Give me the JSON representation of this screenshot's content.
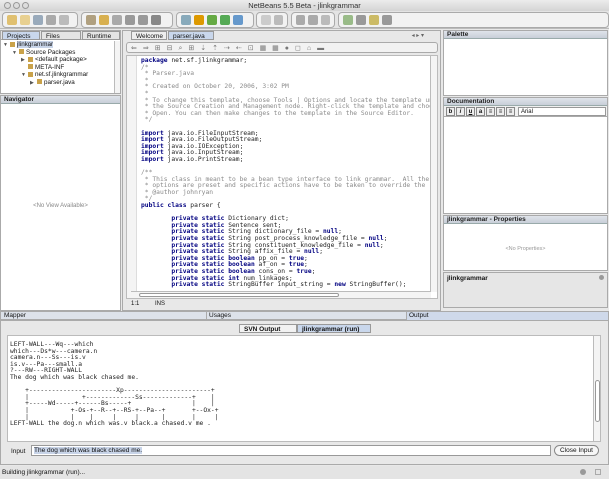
{
  "window": {
    "title": "NetBeans 5.5 Beta - jlinkgrammar"
  },
  "left": {
    "tabs": [
      "Projects",
      "Files",
      "Runtime"
    ],
    "tree": [
      {
        "label": "jlinkgrammar",
        "depth": 0,
        "expander": "▼"
      },
      {
        "label": "Source Packages",
        "depth": 1,
        "expander": "▼"
      },
      {
        "label": "<default package>",
        "depth": 2,
        "expander": "▶"
      },
      {
        "label": "META-INF",
        "depth": 2,
        "expander": ""
      },
      {
        "label": "net.sf.jlinkgrammar",
        "depth": 2,
        "expander": "▼"
      },
      {
        "label": "parser.java",
        "depth": 3,
        "expander": "▶"
      }
    ],
    "navigator_title": "Navigator",
    "navigator_empty": "<No View Available>"
  },
  "editor": {
    "tabs": [
      "Welcome",
      "parser.java"
    ],
    "status_pos": "1:1",
    "status_mode": "INS",
    "lines": [
      [
        [
          "k",
          "package"
        ],
        [
          "n",
          " net.sf.jlinkgrammar;"
        ]
      ],
      [
        [
          "c",
          "/*"
        ]
      ],
      [
        [
          "c",
          " * Parser.java"
        ]
      ],
      [
        [
          "c",
          " *"
        ]
      ],
      [
        [
          "c",
          " * Created on October 20, 2006, 3:02 PM"
        ]
      ],
      [
        [
          "c",
          " *"
        ]
      ],
      [
        [
          "c",
          " * To change this template, choose Tools | Options and locate the template under"
        ]
      ],
      [
        [
          "c",
          " * the Source Creation and Management node. Right-click the template and choose"
        ]
      ],
      [
        [
          "c",
          " * Open. You can then make changes to the template in the Source Editor."
        ]
      ],
      [
        [
          "c",
          " */"
        ]
      ],
      [],
      [
        [
          "k",
          "import"
        ],
        [
          "n",
          " java.io.FileInputStream;"
        ]
      ],
      [
        [
          "k",
          "import"
        ],
        [
          "n",
          " java.io.FileOutputStream;"
        ]
      ],
      [
        [
          "k",
          "import"
        ],
        [
          "n",
          " java.io.IOException;"
        ]
      ],
      [
        [
          "k",
          "import"
        ],
        [
          "n",
          " java.io.InputStream;"
        ]
      ],
      [
        [
          "k",
          "import"
        ],
        [
          "n",
          " java.io.PrintStream;"
        ]
      ],
      [],
      [
        [
          "c",
          "/**"
        ]
      ],
      [
        [
          "c",
          " * This class in meant to be a bean type interface to link grammar.  All the"
        ]
      ],
      [
        [
          "c",
          " * options are preset and specific actions have to be taken to override the"
        ]
      ],
      [
        [
          "c",
          " * @author johnryan"
        ]
      ],
      [
        [
          "c",
          " */"
        ]
      ],
      [
        [
          "k",
          "public class"
        ],
        [
          "n",
          " parser {"
        ]
      ],
      [],
      [
        [
          "n",
          "        "
        ],
        [
          "k",
          "private static"
        ],
        [
          "n",
          " Dictionary dict;"
        ]
      ],
      [
        [
          "n",
          "        "
        ],
        [
          "k",
          "private static"
        ],
        [
          "n",
          " Sentence sent;"
        ]
      ],
      [
        [
          "n",
          "        "
        ],
        [
          "k",
          "private static"
        ],
        [
          "n",
          " String dictionary_file = "
        ],
        [
          "k",
          "null"
        ],
        [
          "n",
          ";"
        ]
      ],
      [
        [
          "n",
          "        "
        ],
        [
          "k",
          "private static"
        ],
        [
          "n",
          " String post_process_knowledge_file = "
        ],
        [
          "k",
          "null"
        ],
        [
          "n",
          ";"
        ]
      ],
      [
        [
          "n",
          "        "
        ],
        [
          "k",
          "private static"
        ],
        [
          "n",
          " String constituent_knowledge_file = "
        ],
        [
          "k",
          "null"
        ],
        [
          "n",
          ";"
        ]
      ],
      [
        [
          "n",
          "        "
        ],
        [
          "k",
          "private static"
        ],
        [
          "n",
          " String affix_file = "
        ],
        [
          "k",
          "null"
        ],
        [
          "n",
          ";"
        ]
      ],
      [
        [
          "n",
          "        "
        ],
        [
          "k",
          "private static boolean"
        ],
        [
          "n",
          " pp_on = "
        ],
        [
          "k",
          "true"
        ],
        [
          "n",
          ";"
        ]
      ],
      [
        [
          "n",
          "        "
        ],
        [
          "k",
          "private static boolean"
        ],
        [
          "n",
          " af_on = "
        ],
        [
          "k",
          "true"
        ],
        [
          "n",
          ";"
        ]
      ],
      [
        [
          "n",
          "        "
        ],
        [
          "k",
          "private static boolean"
        ],
        [
          "n",
          " cons_on = "
        ],
        [
          "k",
          "true"
        ],
        [
          "n",
          ";"
        ]
      ],
      [
        [
          "n",
          "        "
        ],
        [
          "k",
          "private static int"
        ],
        [
          "n",
          " num_linkages;"
        ]
      ],
      [
        [
          "n",
          "        "
        ],
        [
          "k",
          "private static"
        ],
        [
          "n",
          " StringBuffer input_string = "
        ],
        [
          "k",
          "new"
        ],
        [
          "n",
          " StringBuffer();"
        ]
      ]
    ]
  },
  "right": {
    "palette_title": "Palette",
    "doc_title": "Documentation",
    "format_buttons": [
      "b",
      "i",
      "u",
      "a",
      "≡",
      "≡",
      "≡"
    ],
    "font": "Arial",
    "props_title": "jlinkgrammar - Properties",
    "props_empty": "<No Properties>",
    "node_title": "jlinkgrammar"
  },
  "bottom": {
    "headers": [
      "Mapper",
      "Usages",
      "Output"
    ],
    "tabs": [
      "SVN Output",
      "jlinkgrammar (run)"
    ],
    "output": "LEFT-WALL---Wq---which\nwhich---Ds*w---camera.n\ncamera.n---Ss---is.v\nis.v---Pa---small.a\n?---RW---RIGHT-WALL\nThe dog which was black chased me.\n\n    +-----------------------Xp-----------------------+\n    |              +-------------Ss-------------+    |\n    +-----Wd-----+------Bs-----+                |    |\n    |           +-Os-+--R--+--RS-+--Pa--+       +--Ox-+\n    |           |    |     |     |      |       |     |\nLEFT-WALL the dog.n which was.v black.a chased.v me .",
    "input_label": "Input",
    "input_value": "The dog which was black chased me.",
    "close_input": "Close Input"
  },
  "status": {
    "text": "Building jlinkgrammar (run)..."
  }
}
